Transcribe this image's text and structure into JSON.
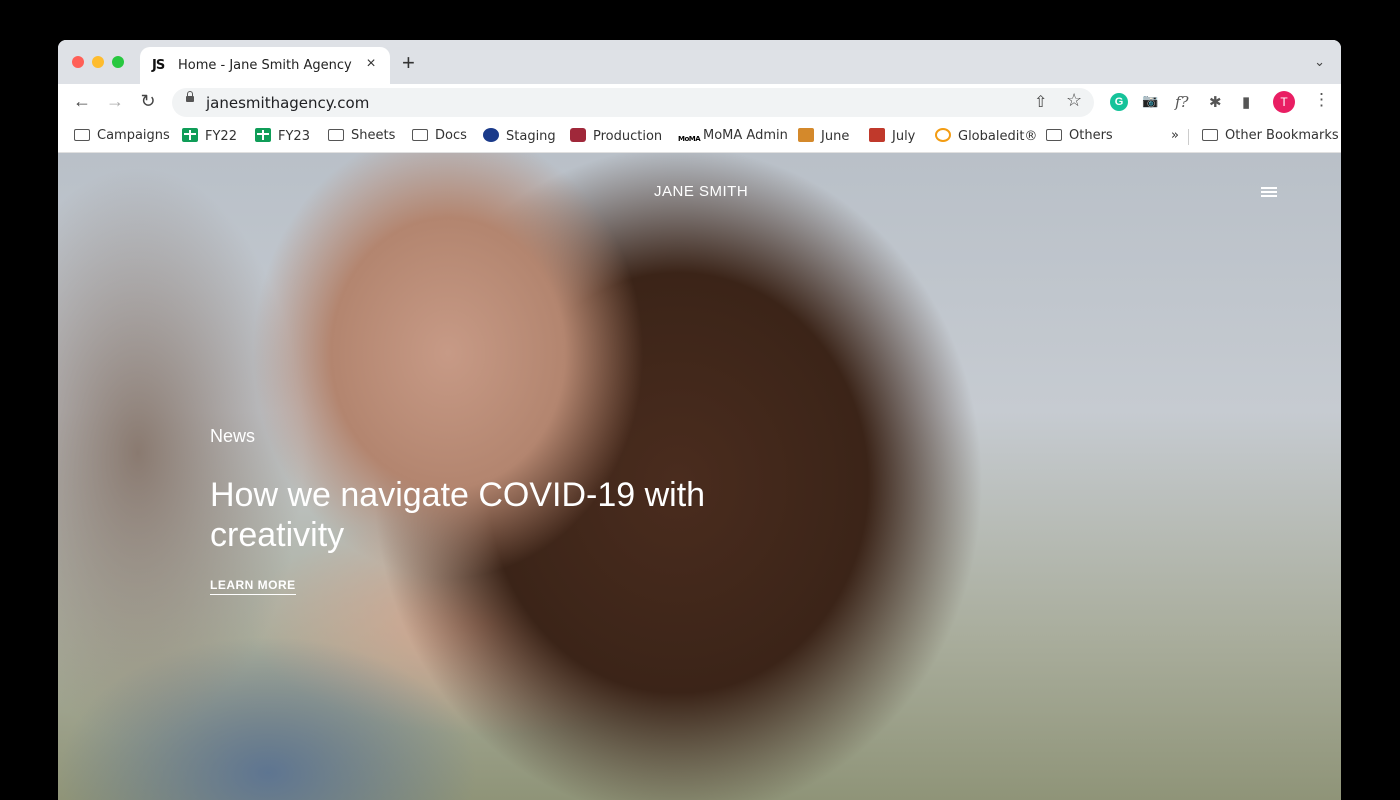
{
  "browser": {
    "tab": {
      "favicon": "JS",
      "title": "Home - Jane Smith Agency",
      "close": "×"
    },
    "new_tab": "+",
    "tab_menu": "⌄",
    "url": "janesmithagency.com",
    "nav": {
      "back": "←",
      "forward": "→",
      "reload": "↻"
    },
    "omnibox_icons": {
      "share": "⇧",
      "star": "☆"
    },
    "extensions": {
      "grammarly": "G",
      "camera": "📷",
      "font": "f?",
      "puzzle": "✱",
      "sidepanel": "▮",
      "menu": "⋮"
    },
    "profile_initial": "T"
  },
  "bookmarks": [
    {
      "label": "Campaigns",
      "icon": "folder-icon"
    },
    {
      "label": "FY22",
      "icon": "sheets-icon"
    },
    {
      "label": "FY23",
      "icon": "sheets-icon"
    },
    {
      "label": "Sheets",
      "icon": "folder-icon"
    },
    {
      "label": "Docs",
      "icon": "folder-icon"
    },
    {
      "label": "Staging",
      "icon": "staging-icon"
    },
    {
      "label": "Production",
      "icon": "production-icon"
    },
    {
      "label": "MoMA Admin",
      "icon": "moma-icon"
    },
    {
      "label": "June",
      "icon": "trello-icon"
    },
    {
      "label": "July",
      "icon": "trello-icon"
    },
    {
      "label": "Globaledit®",
      "icon": "globaledit-icon"
    },
    {
      "label": "Others",
      "icon": "folder-icon"
    }
  ],
  "bookmarks_overflow": "»",
  "other_bookmarks": "Other Bookmarks",
  "moma_glyph": "MoMA",
  "site": {
    "logo": "JANE SMITH",
    "hero": {
      "kicker": "News",
      "headline": "How we navigate COVID-19 with creativity",
      "cta": "LEARN MORE"
    }
  }
}
